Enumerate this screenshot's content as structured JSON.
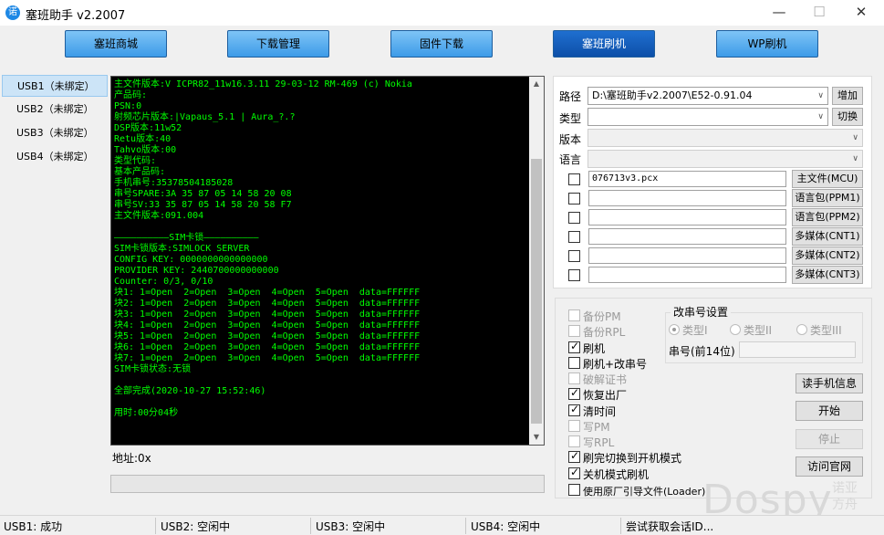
{
  "window": {
    "title": "塞班助手 v2.2007",
    "icon": "app-logo-icon",
    "controls": [
      "—",
      "☐",
      "✕"
    ]
  },
  "nav": [
    {
      "label": "塞班商城"
    },
    {
      "label": "下载管理"
    },
    {
      "label": "固件下载"
    },
    {
      "label": "塞班刷机"
    },
    {
      "label": "WP刷机"
    }
  ],
  "usb_list": [
    {
      "label": "USB1（未绑定）"
    },
    {
      "label": "USB2（未绑定）"
    },
    {
      "label": "USB3（未绑定）"
    },
    {
      "label": "USB4（未绑定）"
    }
  ],
  "console": {
    "text": "主文件版本:V ICPR82_11w16.3.11 29-03-12 RM-469 (c) Nokia\n产品码:\nPSN:0\n射频芯片版本:|Vapaus_5.1 | Aura_?.?\nDSP版本:11w52\nRetu版本:40\nTahvo版本:00\n类型代码:\n基本产品码:\n手机串号:35378504185028\n串号SPARE:3A 35 87 05 14 58 20 08\n串号SV:33 35 87 05 14 58 20 58 F7\n主文件版本:091.004\n\n——————————SIM卡锁——————————\nSIM卡锁版本:SIMLOCK SERVER\nCONFIG KEY: 0000000000000000\nPROVIDER KEY: 2440700000000000\nCounter: 0/3, 0/10\n块1: 1=Open  2=Open  3=Open  4=Open  5=Open  data=FFFFFF\n块2: 1=Open  2=Open  3=Open  4=Open  5=Open  data=FFFFFF\n块3: 1=Open  2=Open  3=Open  4=Open  5=Open  data=FFFFFF\n块4: 1=Open  2=Open  3=Open  4=Open  5=Open  data=FFFFFF\n块5: 1=Open  2=Open  3=Open  4=Open  5=Open  data=FFFFFF\n块6: 1=Open  2=Open  3=Open  4=Open  5=Open  data=FFFFFF\n块7: 1=Open  2=Open  3=Open  4=Open  5=Open  data=FFFFFF\nSIM卡锁状态:无锁\n\n全部完成(2020-10-27 15:52:46)\n\n用时:00分04秒"
  },
  "address": {
    "label": "地址:0x"
  },
  "settings": {
    "path_label": "路径",
    "path_value": "D:\\塞班助手v2.2007\\E52-0.91.04",
    "add_button": "增加",
    "type_label": "类型",
    "type_value": "",
    "switch_button": "切换",
    "version_label": "版本",
    "language_label": "语言"
  },
  "files": [
    {
      "value": "076713v3.pcx",
      "button": "主文件(MCU)",
      "checked": false
    },
    {
      "value": "",
      "button": "语言包(PPM1)",
      "checked": false
    },
    {
      "value": "",
      "button": "语言包(PPM2)",
      "checked": false
    },
    {
      "value": "",
      "button": "多媒体(CNT1)",
      "checked": false
    },
    {
      "value": "",
      "button": "多媒体(CNT2)",
      "checked": false
    },
    {
      "value": "",
      "button": "多媒体(CNT3)",
      "checked": false
    }
  ],
  "options": [
    {
      "label": "备份PM",
      "checked": false,
      "enabled": false
    },
    {
      "label": "备份RPL",
      "checked": false,
      "enabled": false
    },
    {
      "label": "刷机",
      "checked": true,
      "enabled": true
    },
    {
      "label": "刷机+改串号",
      "checked": false,
      "enabled": true
    },
    {
      "label": "破解证书",
      "checked": false,
      "enabled": false
    },
    {
      "label": "恢复出厂",
      "checked": true,
      "enabled": true
    },
    {
      "label": "清时间",
      "checked": true,
      "enabled": true
    },
    {
      "label": "写PM",
      "checked": false,
      "enabled": false
    },
    {
      "label": "写RPL",
      "checked": false,
      "enabled": false
    },
    {
      "label": "刷完切换到开机模式",
      "checked": true,
      "enabled": true
    },
    {
      "label": "关机模式刷机",
      "checked": true,
      "enabled": true
    },
    {
      "label": "使用原厂引导文件(Loader)",
      "checked": false,
      "enabled": true
    }
  ],
  "imei_settings": {
    "title": "改串号设置",
    "types": [
      {
        "label": "类型I",
        "selected": true
      },
      {
        "label": "类型II",
        "selected": false
      },
      {
        "label": "类型III",
        "selected": false
      }
    ],
    "imei_label": "串号(前14位)",
    "imei_value": ""
  },
  "actions": [
    {
      "label": "读手机信息",
      "enabled": true
    },
    {
      "label": "开始",
      "enabled": true
    },
    {
      "label": "停止",
      "enabled": false
    },
    {
      "label": "访问官网",
      "enabled": true
    }
  ],
  "status": [
    {
      "text": "USB1: 成功"
    },
    {
      "text": "USB2: 空闲中"
    },
    {
      "text": "USB3: 空闲中"
    },
    {
      "text": "USB4: 空闲中"
    },
    {
      "text": "尝试获取会话ID..."
    }
  ],
  "watermark": {
    "brand": "Dospy",
    "line1": "诺亚",
    "line2": "方舟"
  }
}
